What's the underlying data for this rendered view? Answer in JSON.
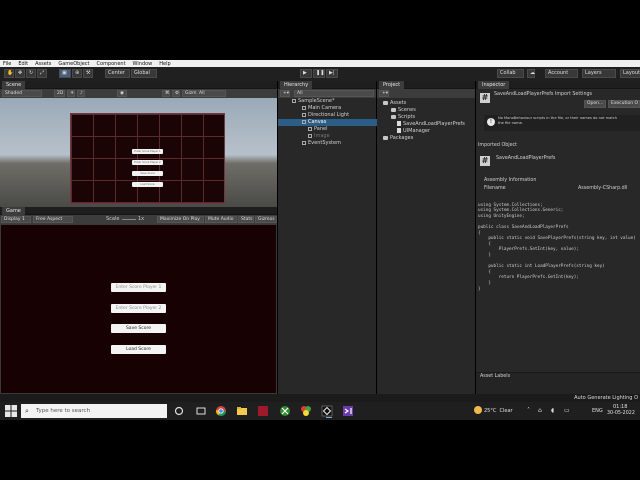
{
  "menubar": {
    "items": [
      "File",
      "Edit",
      "Assets",
      "GameObject",
      "Component",
      "Window",
      "Help"
    ]
  },
  "toolbar": {
    "pivot": "Center",
    "space": "Global",
    "right": {
      "collab": "Collab",
      "account": "Account",
      "layers": "Layers",
      "layout": "Layout"
    }
  },
  "scene": {
    "tab": "Scene",
    "shading": "Shaded",
    "mode2d": "2D",
    "gizmos": "Gizmos",
    "search": "All",
    "mini_buttons": [
      "Enter Score Player 1",
      "Enter Score Player 2",
      "Save Score",
      "Load Score"
    ]
  },
  "game": {
    "tab": "Game",
    "display": "Display 1",
    "aspect": "Free Aspect",
    "scale_label": "Scale",
    "scale_value": "1x",
    "toggles": [
      "Maximize On Play",
      "Mute Audio",
      "Stats",
      "Gizmos"
    ],
    "input1": "Enter Score Player 1",
    "input2": "Enter Score Player 2",
    "save": "Save Score",
    "load": "Load Score"
  },
  "hierarchy": {
    "tab": "Hierarchy",
    "search": "All",
    "items": [
      "SampleScene*",
      "Main Camera",
      "Directional Light",
      "Canvas",
      "Panel",
      "Image",
      "EventSystem"
    ]
  },
  "project": {
    "tab": "Project",
    "items": [
      "Assets",
      "Scenes",
      "Scripts",
      "SaveAndLoadPlayerPrefs",
      "UIManager",
      "Packages"
    ]
  },
  "inspector": {
    "tab": "Inspector",
    "title": "SaveAndLoadPlayerPrefs Import Settings",
    "open": "Open...",
    "exec": "Execution O",
    "warning_line1": "No MonoBehaviour scripts in the file, or their names do not match",
    "warning_line2": "the file name.",
    "imported_object": "Imported Object",
    "object_name": "SaveAndLoadPlayerPrefs",
    "assembly_info": "Assembly Information",
    "filename_label": "Filename",
    "filename_value": "Assembly-CSharp.dll",
    "code": [
      "using System.Collections;",
      "using System.Collections.Generic;",
      "using UnityEngine;",
      "",
      "public class SaveAndLoadPlayerPrefs",
      "{",
      "    public static void SavePlayerPrefs(string key, int value)",
      "    {",
      "        PlayerPrefs.SetInt(key, value);",
      "    }",
      "",
      "    public static int LoadPlayerPrefs(string key)",
      "    {",
      "        return PlayerPrefs.GetInt(key);",
      "    }",
      "}"
    ],
    "asset_labels": "Asset Labels"
  },
  "status": {
    "right": "Auto Generate Lighting O"
  },
  "taskbar": {
    "search_placeholder": "Type here to search",
    "weather": "25°C  Clear",
    "lang": "ENG",
    "time": "01:18",
    "date": "30-05-2022"
  }
}
